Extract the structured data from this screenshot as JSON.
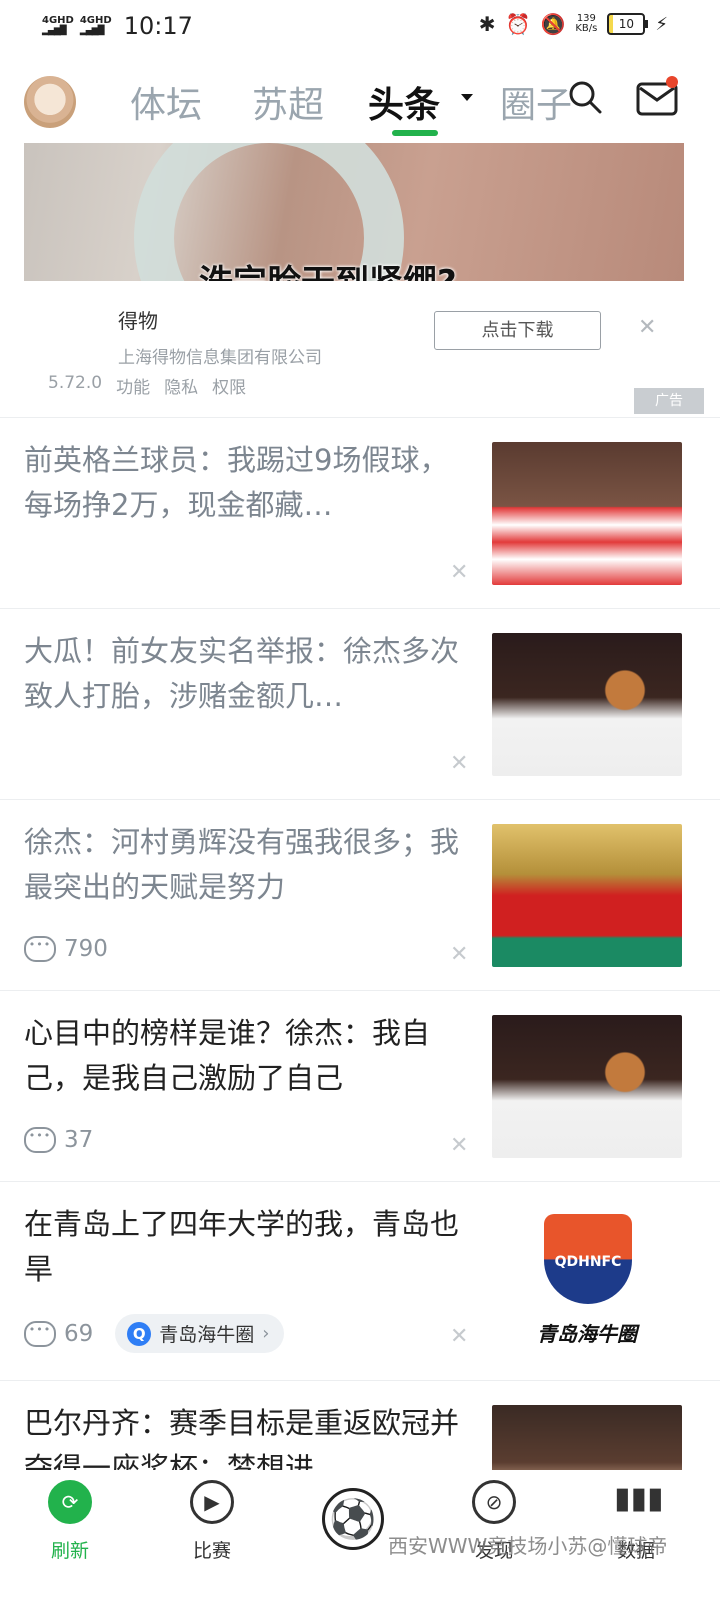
{
  "status": {
    "signal1": "4GHD",
    "signal2": "4GHD",
    "time": "10:17",
    "speed_value": "139",
    "speed_unit": "KB/s",
    "battery": "10"
  },
  "nav": {
    "tabs": [
      "体坛",
      "苏超",
      "头条",
      "圈子"
    ],
    "active_tab": "头条"
  },
  "ad": {
    "caption": "洗完脸干到紧绷?",
    "app_name": "得物",
    "company": "上海得物信息集团有限公司",
    "version": "5.72.0",
    "links": [
      "功能",
      "隐私",
      "权限"
    ],
    "download_label": "点击下载",
    "badge": "广告"
  },
  "news": [
    {
      "title": "前英格兰球员：我踢过9场假球，每场挣2万，现金都藏…",
      "read": true
    },
    {
      "title": "大瓜！前女友实名举报：徐杰多次致人打胎，涉赌金额几…",
      "read": true
    },
    {
      "title": "徐杰：河村勇辉没有强我很多；我最突出的天赋是努力",
      "read": true,
      "comments": "790"
    },
    {
      "title": "心目中的榜样是谁？徐杰：我自己，是我自己激励了自己",
      "read": false,
      "comments": "37"
    },
    {
      "title": "在青岛上了四年大学的我，青岛也旱",
      "read": false,
      "comments": "69",
      "circle": "青岛海牛圈",
      "logo_text": "青岛海牛圈",
      "logo_badge": "QDHNFC"
    },
    {
      "title": "巴尔丹齐：赛季目标是重返欧冠并夺得一座奖杯；梦想进…",
      "read": false
    }
  ],
  "bottom_nav": [
    {
      "label": "刷新",
      "icon": "refresh-icon",
      "active": true
    },
    {
      "label": "比赛",
      "icon": "play-icon",
      "active": false
    },
    {
      "label": "",
      "icon": "soccer-ball-icon",
      "active": false
    },
    {
      "label": "发现",
      "icon": "planet-icon",
      "active": false
    },
    {
      "label": "数据",
      "icon": "bar-chart-icon",
      "active": false
    }
  ],
  "watermark": "西安WWW竞技场小苏@懂球帝",
  "colors": {
    "accent": "#22b24c",
    "notification": "#e8452b"
  }
}
